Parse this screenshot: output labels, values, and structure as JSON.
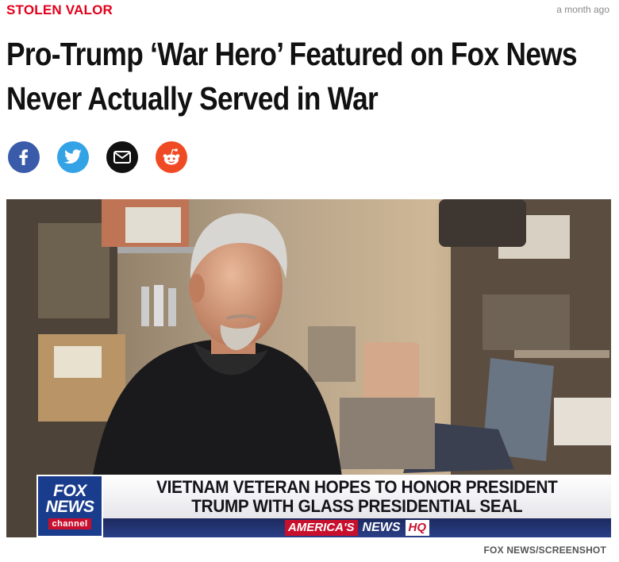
{
  "article": {
    "kicker": "STOLEN VALOR",
    "timestamp": "a month ago",
    "headline_line1": "Pro-Trump ‘War Hero’ Featured on Fox News",
    "headline_line2": "Never Actually Served in War"
  },
  "share": {
    "icons": [
      "facebook-icon",
      "twitter-icon",
      "email-icon",
      "reddit-icon"
    ],
    "colors": {
      "facebook": "#3a5ba9",
      "twitter": "#33a3e6",
      "email": "#111111",
      "reddit": "#ef4a23"
    }
  },
  "image": {
    "logo_line1": "FOX",
    "logo_line2": "NEWS",
    "logo_line3": "channel",
    "chyron_line1": "VIETNAM VETERAN HOPES TO HONOR PRESIDENT",
    "chyron_line2": "TRUMP WITH GLASS PRESIDENTIAL SEAL",
    "sub_part1": "AMERICA'S",
    "sub_part2": "NEWS",
    "sub_part3": "HQ",
    "credit": "FOX NEWS/SCREENSHOT"
  }
}
